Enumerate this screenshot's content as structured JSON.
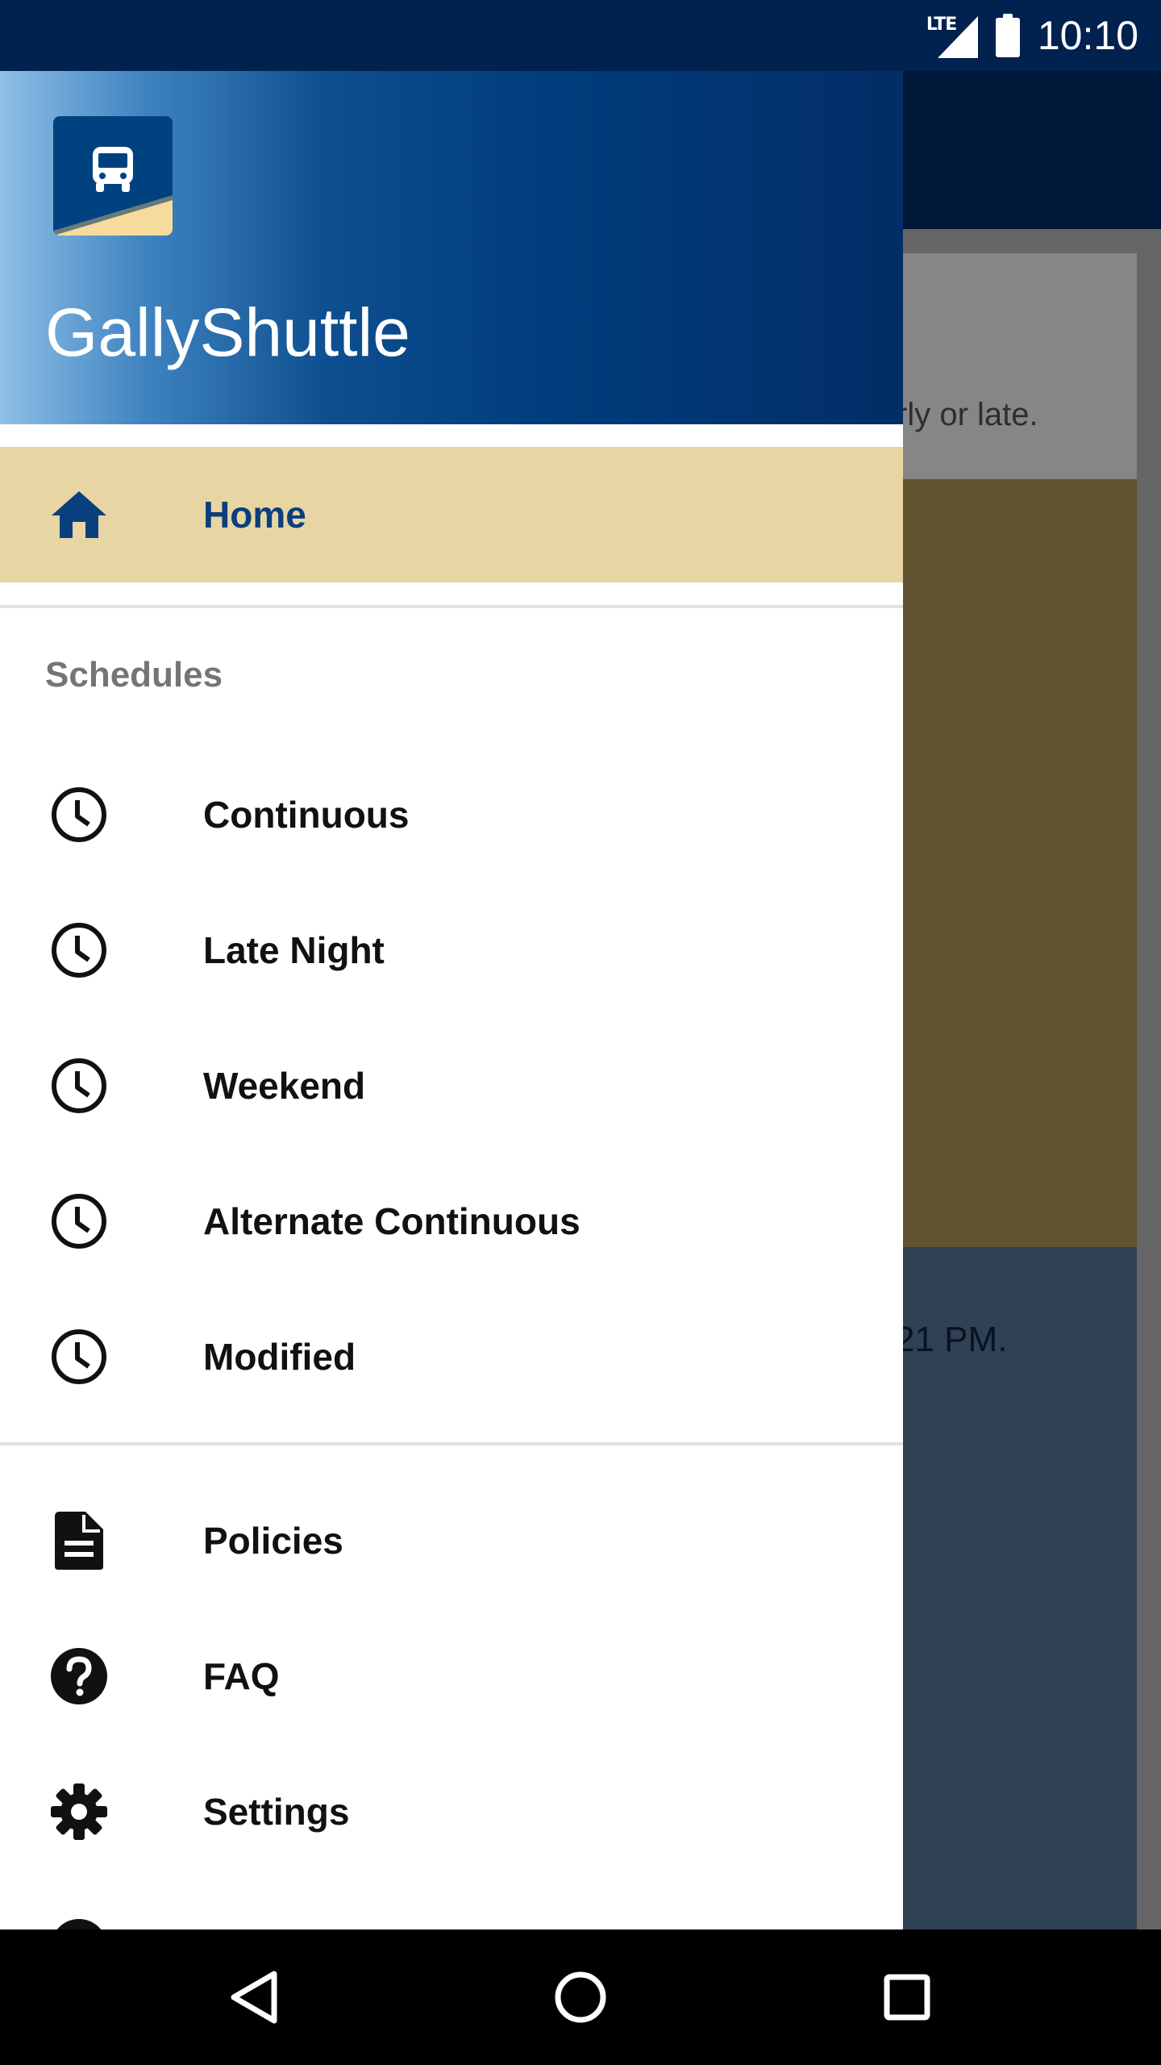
{
  "status_bar": {
    "network": "LTE",
    "time": "10:10",
    "icons": [
      "lte-signal-icon",
      "battery-icon"
    ]
  },
  "background_app": {
    "card_text": "rly or late.",
    "info_text": "21 PM.",
    "colors": {
      "toolbar": "#012f6b",
      "tan_panel": "#b49a57",
      "blue_panel": "#5a7899"
    }
  },
  "drawer": {
    "app_name": "GallyShuttle",
    "logo_icon": "bus-icon",
    "home": {
      "label": "Home",
      "icon": "home-icon"
    },
    "schedules_header": "Schedules",
    "schedules": [
      {
        "label": "Continuous",
        "icon": "clock-icon"
      },
      {
        "label": "Late Night",
        "icon": "clock-icon"
      },
      {
        "label": "Weekend",
        "icon": "clock-icon"
      },
      {
        "label": "Alternate Continuous",
        "icon": "clock-icon"
      },
      {
        "label": "Modified",
        "icon": "clock-icon"
      }
    ],
    "other": [
      {
        "label": "Policies",
        "icon": "document-icon"
      },
      {
        "label": "FAQ",
        "icon": "help-icon"
      },
      {
        "label": "Settings",
        "icon": "gear-icon"
      }
    ],
    "colors": {
      "accent": "#e8d5a4",
      "brand_blue": "#0a3f7d"
    }
  },
  "nav_bar": {
    "buttons": [
      "back-icon",
      "home-circle-icon",
      "recents-icon"
    ]
  }
}
